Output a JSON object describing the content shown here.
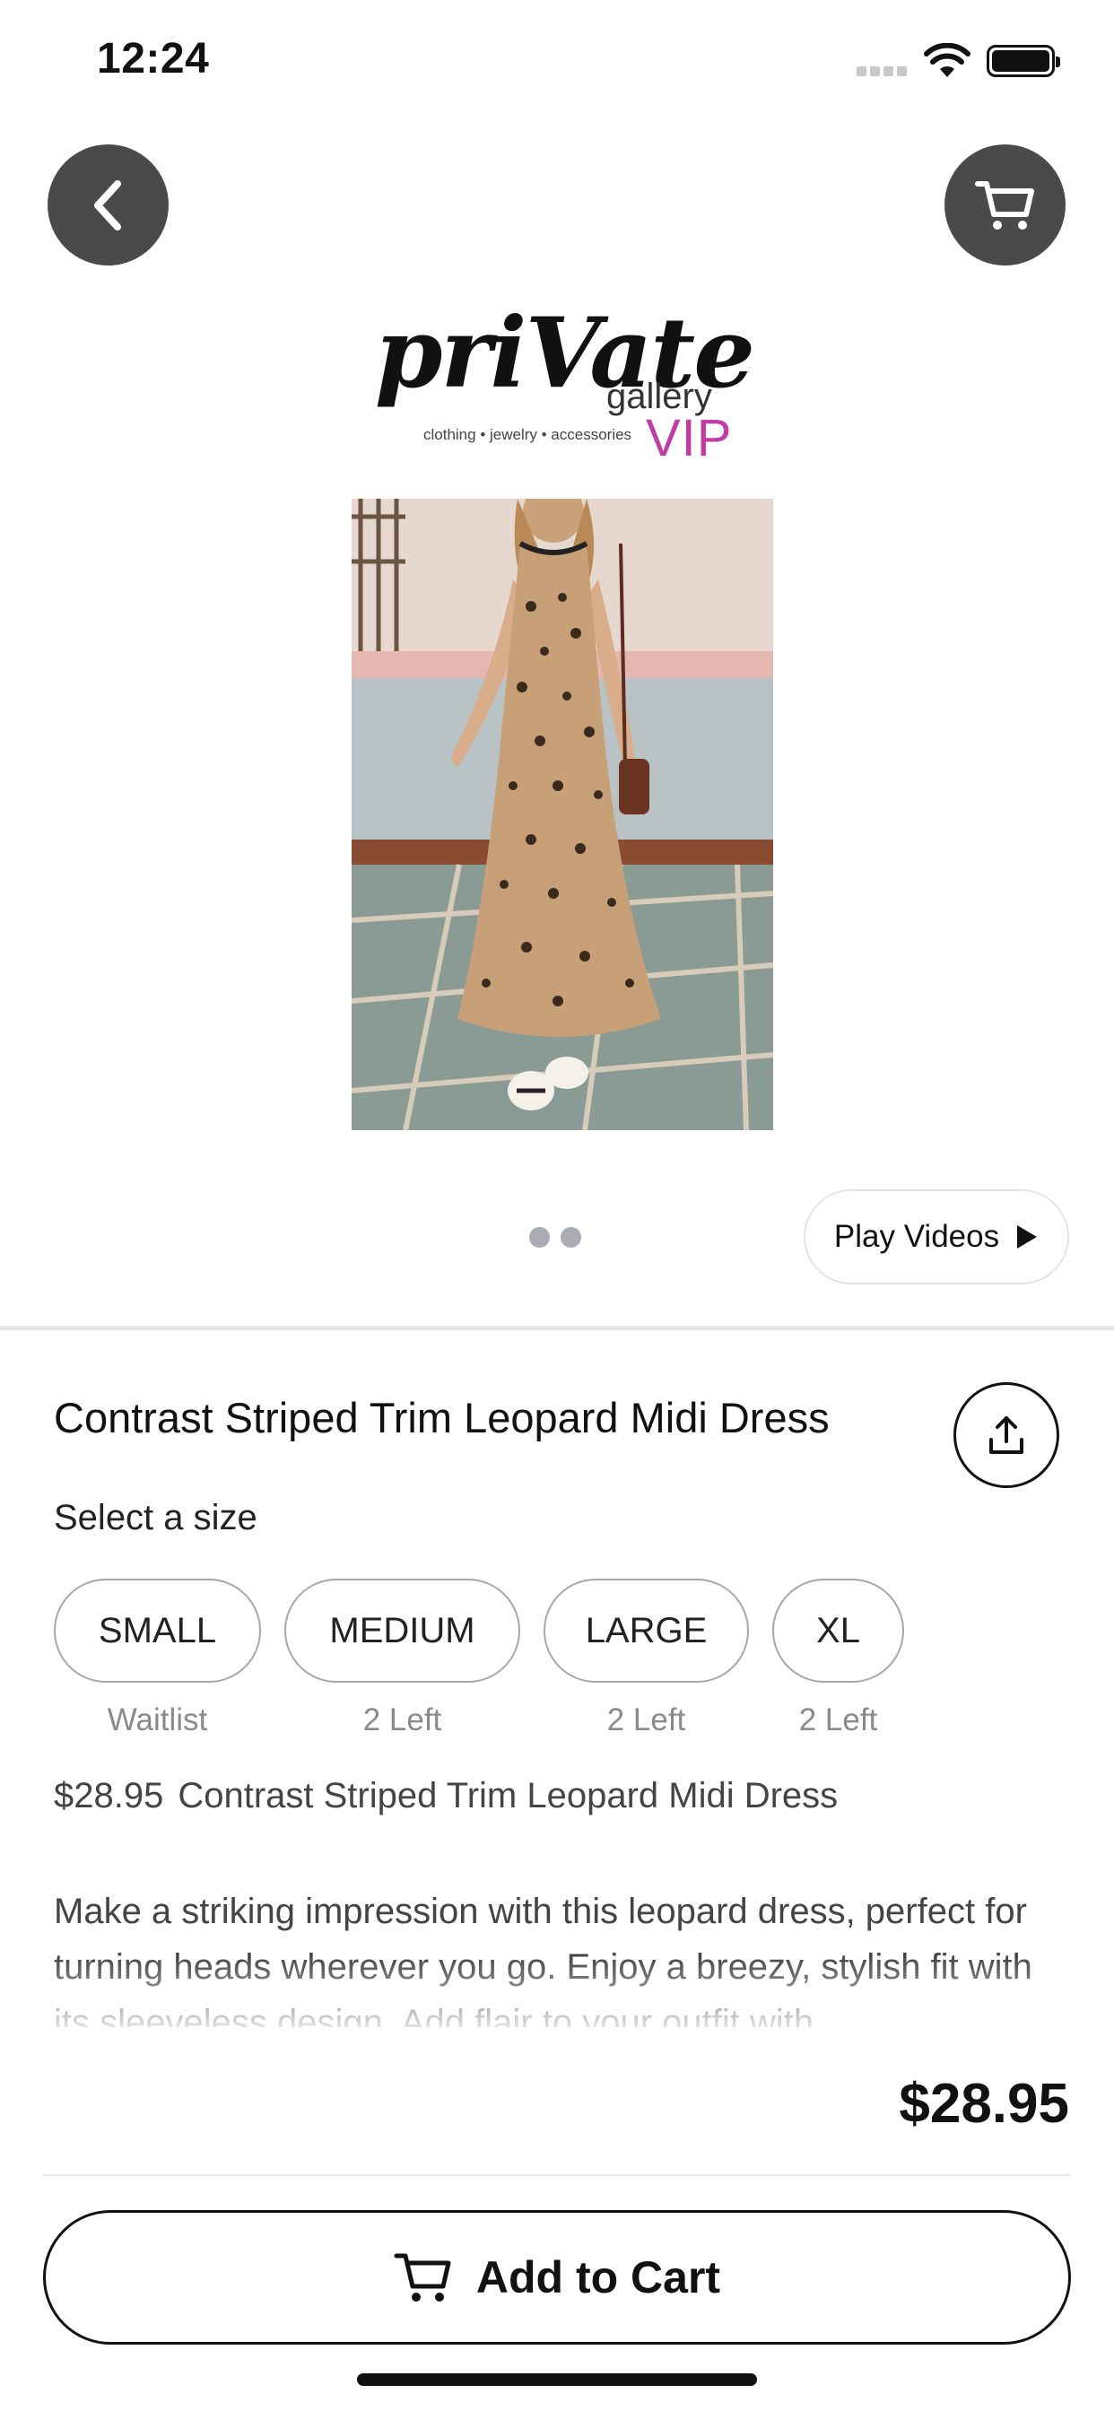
{
  "status_bar": {
    "time": "12:24"
  },
  "header": {
    "back_icon": "chevron-left-icon",
    "cart_icon": "cart-icon"
  },
  "brand": {
    "name_main": "priVate",
    "name_sub": "gallery",
    "tagline": "clothing • jewelry • accessories",
    "vip": "VIP",
    "vip_color": "#c03da6"
  },
  "media": {
    "image_alt": "Leopard midi dress product photo",
    "page_count": 2,
    "play_videos_label": "Play Videos"
  },
  "product": {
    "title": "Contrast Striped Trim Leopard Midi Dress",
    "select_size_label": "Select a size",
    "sizes": [
      {
        "label": "SMALL",
        "availability": "Waitlist"
      },
      {
        "label": "MEDIUM",
        "availability": "2 Left"
      },
      {
        "label": "LARGE",
        "availability": "2 Left"
      },
      {
        "label": "XL",
        "availability": "2 Left"
      }
    ],
    "price": "$28.95",
    "price_name": "Contrast Striped Trim Leopard Midi Dress",
    "description": "Make a striking impression with this leopard dress, perfect for turning heads wherever you go. Enjoy a breezy, stylish fit with its sleeveless design. Add flair to your outfit with"
  },
  "footer": {
    "total_price": "$28.95",
    "add_to_cart_label": "Add to Cart"
  }
}
